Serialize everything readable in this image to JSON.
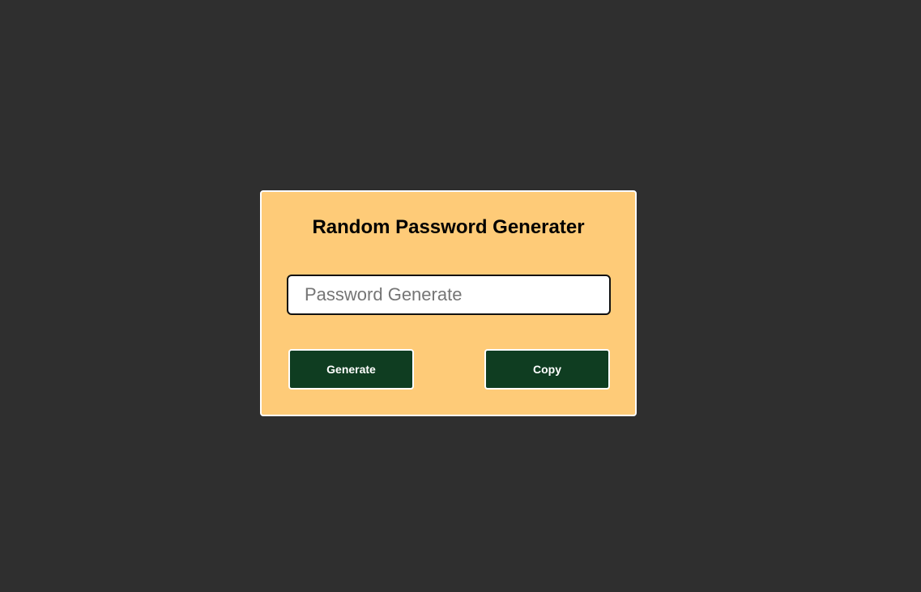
{
  "card": {
    "title": "Random Password Generater",
    "input": {
      "value": "",
      "placeholder": "Password Generate"
    },
    "buttons": {
      "generate_label": "Generate",
      "copy_label": "Copy"
    }
  },
  "colors": {
    "page_background": "#2f2f2f",
    "card_background": "#fecb78",
    "button_background": "#0f3d21",
    "button_text": "#ffffff"
  }
}
